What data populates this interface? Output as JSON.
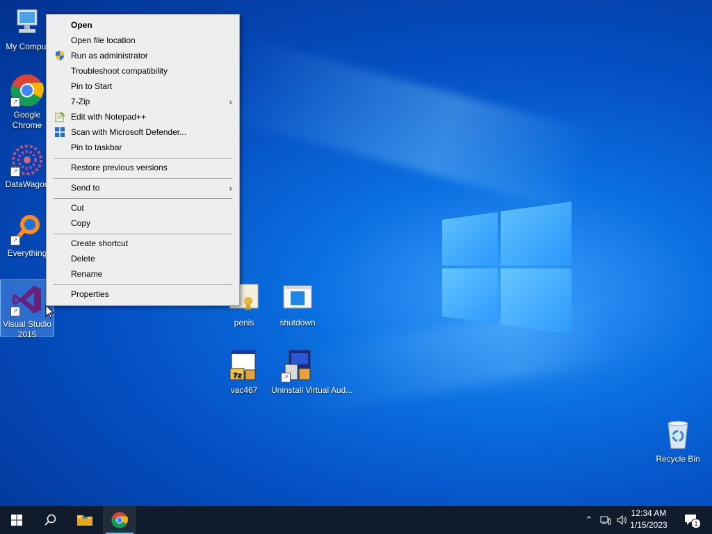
{
  "desktop": {
    "icons": [
      {
        "label": "My Computer",
        "display": "My Comput"
      },
      {
        "label": "Google Chrome"
      },
      {
        "label": "DataWagon"
      },
      {
        "label": "Everything"
      },
      {
        "label": "Visual Studio 2015"
      },
      {
        "label": "penis"
      },
      {
        "label": "shutdown"
      },
      {
        "label": "vac467"
      },
      {
        "label": "Uninstall Virtual Aud..."
      },
      {
        "label": "Recycle Bin"
      }
    ]
  },
  "context_menu": {
    "items": [
      {
        "label": "Open",
        "bold": true
      },
      {
        "label": "Open file location"
      },
      {
        "label": "Run as administrator",
        "icon": "uac-shield-icon"
      },
      {
        "label": "Troubleshoot compatibility"
      },
      {
        "label": "Pin to Start"
      },
      {
        "label": "7-Zip",
        "submenu": true
      },
      {
        "label": "Edit with Notepad++",
        "icon": "notepadpp-icon"
      },
      {
        "label": "Scan with Microsoft Defender...",
        "icon": "defender-icon"
      },
      {
        "label": "Pin to taskbar"
      },
      {
        "label": "Restore previous versions"
      },
      {
        "label": "Send to",
        "submenu": true
      },
      {
        "label": "Cut"
      },
      {
        "label": "Copy"
      },
      {
        "label": "Create shortcut"
      },
      {
        "label": "Delete"
      },
      {
        "label": "Rename"
      },
      {
        "label": "Properties"
      }
    ]
  },
  "taskbar": {
    "pinned": [
      "start-button",
      "search-button",
      "file-explorer",
      "google-chrome"
    ],
    "clock": {
      "time": "12:34 AM",
      "date": "1/15/2023"
    },
    "notifications_count": "1"
  },
  "colors": {
    "accent": "#0078d7",
    "taskbar": "#101c2b",
    "menu_bg": "#eeeeee"
  }
}
